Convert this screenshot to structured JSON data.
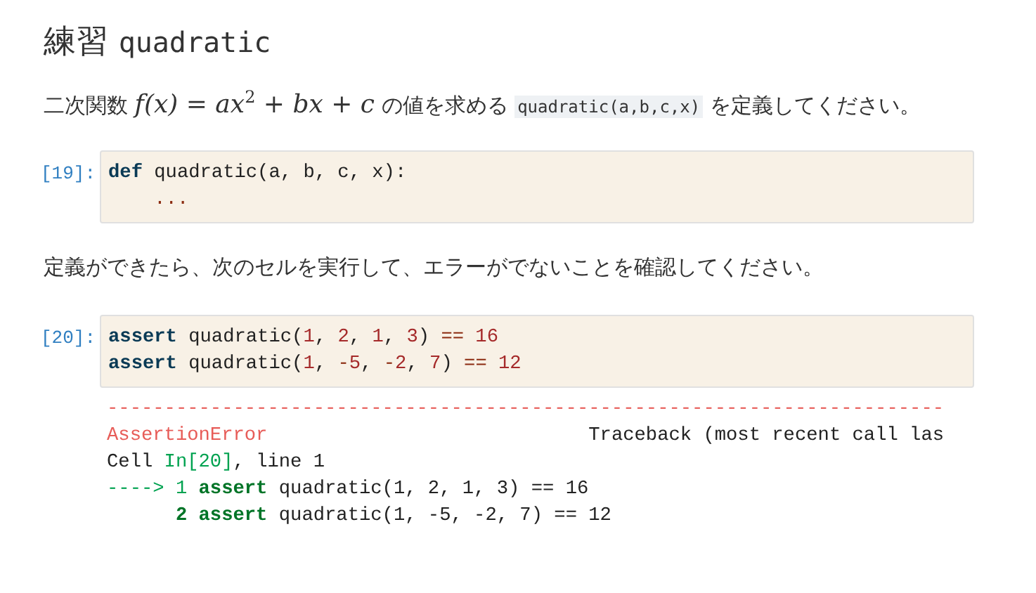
{
  "heading": {
    "word": "練習",
    "code": "quadratic"
  },
  "intro": [
    {
      "kind": "text",
      "text": "二次関数 "
    },
    {
      "kind": "math",
      "text": "f(x) = ax$^{2}$ + bx + c"
    },
    {
      "kind": "text",
      "text": " の値を求める "
    },
    {
      "kind": "code",
      "text": "quadratic(a,b,c,x)"
    },
    {
      "kind": "text",
      "text": " を定義してください。"
    }
  ],
  "cells": [
    {
      "prompt": "[19]:",
      "lines": [
        [
          {
            "kind": "keyword",
            "text": "def"
          },
          {
            "kind": "text",
            "text": " quadratic(a, b, c, x):"
          }
        ],
        [
          {
            "kind": "operator",
            "text": "    ..."
          }
        ]
      ]
    },
    {
      "prompt": "[20]:",
      "lines": [
        [
          {
            "kind": "keyword",
            "text": "assert"
          },
          {
            "kind": "text",
            "text": " quadratic("
          },
          {
            "kind": "number",
            "text": "1"
          },
          {
            "kind": "text",
            "text": ", "
          },
          {
            "kind": "number",
            "text": "2"
          },
          {
            "kind": "text",
            "text": ", "
          },
          {
            "kind": "number",
            "text": "1"
          },
          {
            "kind": "text",
            "text": ", "
          },
          {
            "kind": "number",
            "text": "3"
          },
          {
            "kind": "text",
            "text": ") "
          },
          {
            "kind": "operator",
            "text": "== "
          },
          {
            "kind": "number",
            "text": "16"
          }
        ],
        [
          {
            "kind": "keyword",
            "text": "assert"
          },
          {
            "kind": "text",
            "text": " quadratic("
          },
          {
            "kind": "number",
            "text": "1"
          },
          {
            "kind": "text",
            "text": ", "
          },
          {
            "kind": "operator",
            "text": "-"
          },
          {
            "kind": "number",
            "text": "5"
          },
          {
            "kind": "text",
            "text": ", "
          },
          {
            "kind": "operator",
            "text": "-"
          },
          {
            "kind": "number",
            "text": "2"
          },
          {
            "kind": "text",
            "text": ", "
          },
          {
            "kind": "number",
            "text": "7"
          },
          {
            "kind": "text",
            "text": ") "
          },
          {
            "kind": "operator",
            "text": "== "
          },
          {
            "kind": "number",
            "text": "12"
          }
        ]
      ],
      "output": [
        [
          {
            "kind": "error",
            "text": "-------------------------------------------------------------------------"
          }
        ],
        [
          {
            "kind": "error",
            "text": "AssertionError"
          },
          {
            "kind": "text",
            "text": "                            Traceback (most recent call las"
          }
        ],
        [
          {
            "kind": "text",
            "text": "Cell "
          },
          {
            "kind": "green",
            "text": "In[20]"
          },
          {
            "kind": "text",
            "text": ", line 1"
          }
        ],
        [
          {
            "kind": "green",
            "text": "----> 1 "
          },
          {
            "kind": "greenbold",
            "text": "assert"
          },
          {
            "kind": "text",
            "text": " quadratic(1, 2, 1, 3) == 16"
          }
        ],
        [
          {
            "kind": "greenbold",
            "text": "      2 assert"
          },
          {
            "kind": "text",
            "text": " quadratic(1, -5, -2, 7) == 12"
          }
        ]
      ]
    }
  ],
  "between": [
    "定義ができたら、次のセルを実行して、エラーがでないことを確認してください。"
  ]
}
